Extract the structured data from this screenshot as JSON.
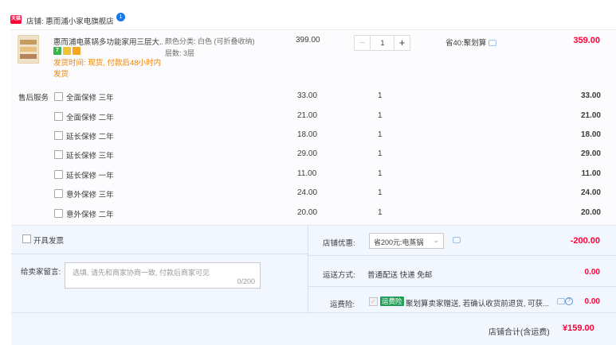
{
  "shop": {
    "badge": "天猫",
    "label": "店铺: 惠而浦小家电旗舰店",
    "wangwang": "1"
  },
  "item": {
    "title": "惠而浦电蒸锅多功能家用三层大...",
    "badges": [
      "7",
      "保",
      "卡"
    ],
    "shipping_note": "发货时间: 现货, 付款后48小时内发货",
    "sku_color": "颜色分类: 白色 (可折叠收纳)",
    "sku_layers": "层数: 3层",
    "price": "399.00",
    "qty": "1",
    "qty_minus": "−",
    "qty_plus": "+",
    "promo": "省40:聚划算",
    "subtotal": "359.00"
  },
  "services": {
    "title": "售后服务",
    "rows": [
      {
        "name": "全面保修 三年",
        "price": "33.00",
        "qty": "1",
        "total": "33.00"
      },
      {
        "name": "全面保修 二年",
        "price": "21.00",
        "qty": "1",
        "total": "21.00"
      },
      {
        "name": "延长保修 二年",
        "price": "18.00",
        "qty": "1",
        "total": "18.00"
      },
      {
        "name": "延长保修 三年",
        "price": "29.00",
        "qty": "1",
        "total": "29.00"
      },
      {
        "name": "延长保修 一年",
        "price": "11.00",
        "qty": "1",
        "total": "11.00"
      },
      {
        "name": "意外保修 三年",
        "price": "24.00",
        "qty": "1",
        "total": "24.00"
      },
      {
        "name": "意外保修 二年",
        "price": "20.00",
        "qty": "1",
        "total": "20.00"
      }
    ]
  },
  "footer": {
    "invoice_label": "开具发票",
    "note_label": "给卖家留言:",
    "note_placeholder": "选填, 请先和商家协商一致, 付款后商家可见",
    "note_count": "0/200",
    "coupon_label": "店铺优惠:",
    "coupon_value": "省200元:电蒸锅",
    "coupon_amount": "-200.00",
    "shipping_label": "运送方式:",
    "shipping_value": "普通配送 快递 免邮",
    "shipping_amount": "0.00",
    "insurance_label": "运费险:",
    "insurance_tag": "运费险",
    "insurance_text": "聚划算卖家赠送, 若确认收货前退货, 可获...",
    "insurance_amount": "0.00",
    "total_label": "店铺合计(含运费)",
    "total_amount": "¥159.00"
  },
  "colors": {
    "accent": "#ff0036",
    "ship_note": "#f08200",
    "panel": "#f2f7ff",
    "insurance_tag": "#22a05a"
  }
}
